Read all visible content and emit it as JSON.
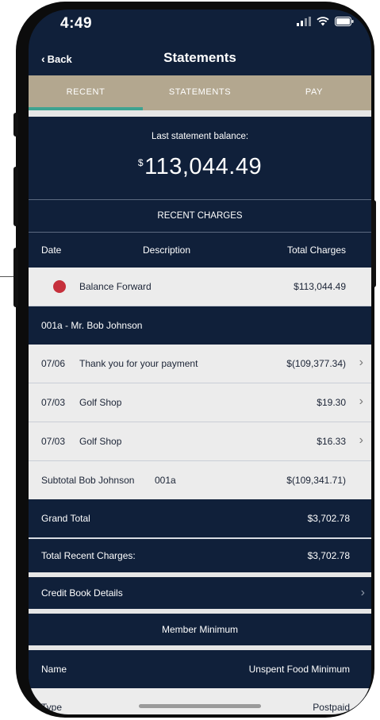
{
  "status_bar": {
    "time": "4:49"
  },
  "nav": {
    "back_label": "Back",
    "title": "Statements"
  },
  "tabs": [
    {
      "label": "RECENT",
      "active": true
    },
    {
      "label": "STATEMENTS",
      "active": false
    },
    {
      "label": "PAY",
      "active": false
    }
  ],
  "balance": {
    "label": "Last statement balance:",
    "currency": "$",
    "amount": "113,044.49"
  },
  "recent_charges": {
    "title": "RECENT CHARGES",
    "columns": {
      "date": "Date",
      "description": "Description",
      "total": "Total Charges"
    },
    "balance_forward": {
      "description": "Balance Forward",
      "amount": "$113,044.49"
    },
    "member_header": "001a - Mr. Bob Johnson",
    "rows": [
      {
        "date": "07/06",
        "description": "Thank you for your payment",
        "amount": "$(109,377.34)"
      },
      {
        "date": "07/03",
        "description": "Golf Shop",
        "amount": "$19.30"
      },
      {
        "date": "07/03",
        "description": "Golf Shop",
        "amount": "$16.33"
      }
    ],
    "subtotal": {
      "label": "Subtotal Bob Johnson",
      "code": "001a",
      "amount": "$(109,341.71)"
    },
    "grand_total": {
      "label": "Grand Total",
      "amount": "$3,702.78"
    },
    "total_recent": {
      "label": "Total Recent Charges:",
      "amount": "$3,702.78"
    }
  },
  "credit_book": {
    "label": "Credit Book Details"
  },
  "member_minimum": {
    "title": "Member Minimum",
    "name": {
      "key": "Name",
      "value": "Unspent Food Minimum"
    },
    "type": {
      "key": "Type",
      "value": "Postpaid"
    }
  },
  "colors": {
    "navy": "#10203a",
    "tan": "#b3a78f",
    "teal": "#3ea391",
    "red_dot": "#c6303c"
  }
}
